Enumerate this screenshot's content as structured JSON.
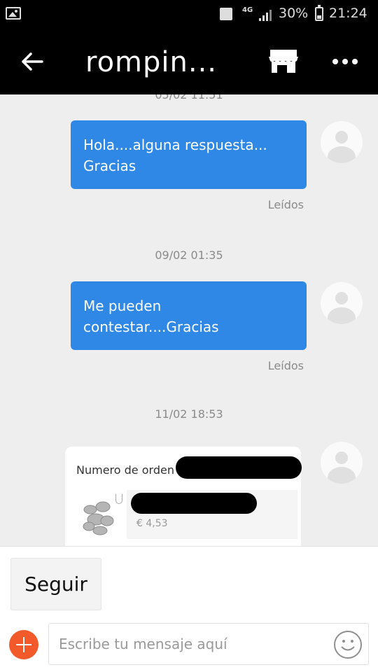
{
  "status_bar": {
    "network": "4G",
    "battery": "30%",
    "time": "21:24"
  },
  "header": {
    "title": "rompin..."
  },
  "icons": {
    "back": "back-arrow-icon",
    "store": "store-icon",
    "more": "more-icon",
    "add": "add-icon",
    "emoji": "smiley-icon",
    "avatar": "user-avatar-icon"
  },
  "chat": {
    "top_timestamp_cut": "05/02 11:51",
    "messages": [
      {
        "text": "Hola....alguna respuesta...\nGracias",
        "read_status": "Leídos"
      },
      {
        "timestamp": "09/02 01:35",
        "text": "Me pueden\ncontestar....Gracias",
        "read_status": "Leídos"
      }
    ],
    "order_timestamp": "11/02 18:53",
    "order_card": {
      "label": "Numero de orden",
      "price": "€ 4,53"
    }
  },
  "bottom": {
    "follow_label": "Seguir",
    "input_placeholder": "Escribe tu mensaje aquí"
  },
  "colors": {
    "bubble": "#2f88e6",
    "accent": "#f25a2c",
    "header": "#000000"
  }
}
